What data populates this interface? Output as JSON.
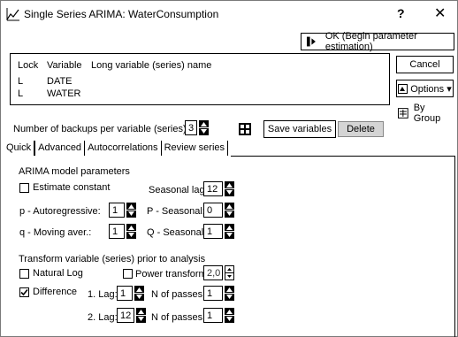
{
  "window": {
    "title": "Single Series ARIMA: WaterConsumption",
    "help": "?",
    "close": "✕"
  },
  "buttons": {
    "ok": "OK (Begin parameter estimation)",
    "cancel": "Cancel",
    "options": "Options ▾",
    "bygroup": "By Group",
    "save_variables": "Save variables",
    "delete": "Delete"
  },
  "variables": {
    "headers": [
      "Lock",
      "Variable",
      "Long variable (series) name"
    ],
    "rows": [
      {
        "lock": "L",
        "variable": "DATE"
      },
      {
        "lock": "L",
        "variable": "WATER"
      }
    ]
  },
  "backups": {
    "label": "Number of backups per variable (series):",
    "value": "3"
  },
  "tabs": [
    "Quick",
    "Advanced",
    "Autocorrelations",
    "Review series"
  ],
  "arima": {
    "section": "ARIMA model parameters",
    "estimate_constant": "Estimate constant",
    "seasonal_lag_label": "Seasonal lag:",
    "seasonal_lag": "12",
    "p_label": "p - Autoregressive:",
    "p": "1",
    "P_label": "P - Seasonal:",
    "P": "0",
    "q_label": "q - Moving aver.:",
    "q": "1",
    "Q_label": "Q - Seasonal:",
    "Q": "1"
  },
  "transform": {
    "section": "Transform variable (series) prior to analysis",
    "natural_log": "Natural Log",
    "power_transform": "Power transform:",
    "power_value": "2,0",
    "difference": "Difference",
    "lag1_label": "1. Lag:",
    "lag1": "1",
    "passes1_label": "N of passes:",
    "passes1": "1",
    "lag2_label": "2. Lag:",
    "lag2": "12",
    "passes2_label": "N of passes:",
    "passes2": "1"
  }
}
